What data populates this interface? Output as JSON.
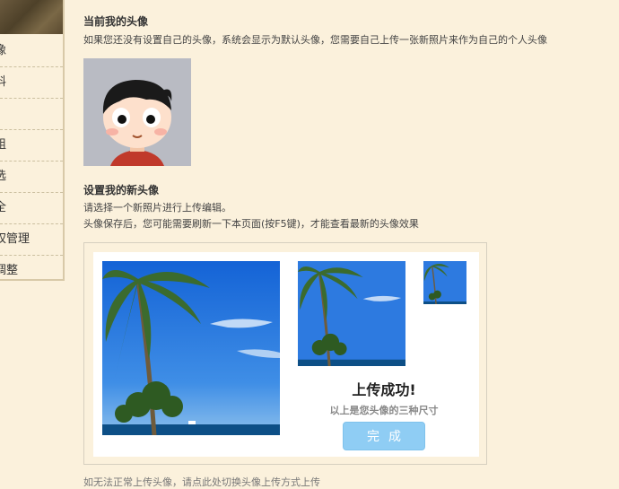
{
  "sidebar": {
    "items": [
      {
        "label": "像"
      },
      {
        "label": "料"
      },
      {
        "label": "·"
      },
      {
        "label": "组"
      },
      {
        "label": "选"
      },
      {
        "label": "全"
      },
      {
        "label": "权管理"
      },
      {
        "label": "调整"
      }
    ]
  },
  "current_avatar": {
    "title": "当前我的头像",
    "description": "如果您还没有设置自己的头像，系统会显示为默认头像，您需要自己上传一张新照片来作为自己的个人头像"
  },
  "new_avatar": {
    "title": "设置我的新头像",
    "line1": "请选择一个新照片进行上传编辑。",
    "line2": "头像保存后，您可能需要刷新一下本页面(按F5键)，才能查看最新的头像效果"
  },
  "upload_panel": {
    "success_title": "上传成功!",
    "success_subtitle": "以上是您头像的三种尺寸",
    "done_label": "完成"
  },
  "footer": {
    "cutoff_text": "如无法正常上传头像，请点此处切换头像上传方式上传"
  },
  "colors": {
    "background": "#fbf1dc",
    "button": "#8fcdf4"
  }
}
